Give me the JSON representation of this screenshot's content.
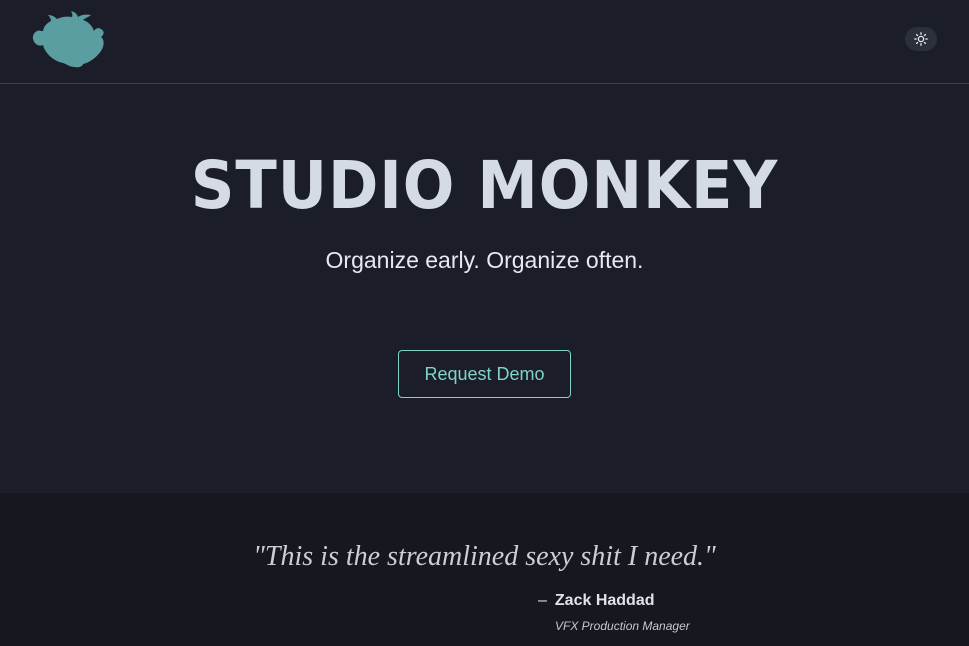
{
  "header": {
    "logo_icon": "monkey-head-logo",
    "theme_toggle_icon": "sun-icon"
  },
  "hero": {
    "title": "STUDIO MONKEY",
    "subtitle": "Organize early. Organize often.",
    "cta_label": "Request Demo"
  },
  "testimonial": {
    "quote": "\"This is the streamlined sexy shit I need.\"",
    "dash": "–",
    "author": "Zack Haddad",
    "role": "VFX Production Manager"
  },
  "colors": {
    "background": "#1b1d28",
    "testimonial_background": "#16171f",
    "accent": "#7fd3c9",
    "logo": "#5b9ea1"
  }
}
